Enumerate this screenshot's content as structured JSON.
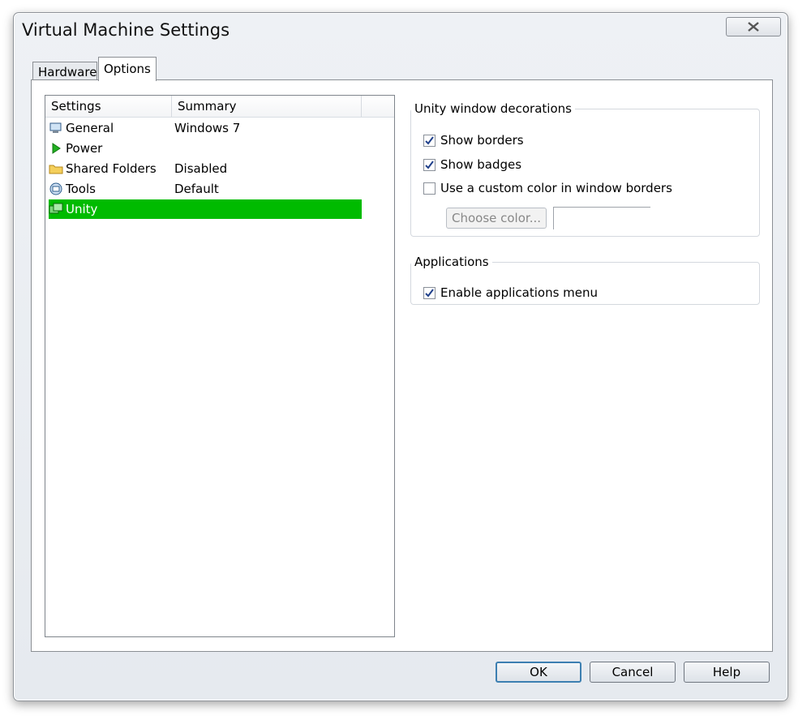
{
  "window": {
    "title": "Virtual Machine Settings"
  },
  "tabs": [
    {
      "label": "Hardware"
    },
    {
      "label": "Options"
    }
  ],
  "list": {
    "headers": {
      "settings": "Settings",
      "summary": "Summary"
    },
    "rows": [
      {
        "label": "General",
        "summary": "Windows 7",
        "icon": "general-icon"
      },
      {
        "label": "Power",
        "summary": "",
        "icon": "power-icon"
      },
      {
        "label": "Shared Folders",
        "summary": "Disabled",
        "icon": "folder-icon"
      },
      {
        "label": "Tools",
        "summary": "Default",
        "icon": "tools-icon"
      },
      {
        "label": "Unity",
        "summary": "",
        "icon": "unity-icon",
        "selected": true
      }
    ]
  },
  "unity_group": {
    "legend": "Unity window decorations",
    "show_borders": {
      "label": "Show borders",
      "checked": true
    },
    "show_badges": {
      "label": "Show badges",
      "checked": true
    },
    "custom_color": {
      "label": "Use a custom color in window borders",
      "checked": false
    },
    "choose_color": "Choose color..."
  },
  "applications_group": {
    "legend": "Applications",
    "enable_menu": {
      "label": "Enable applications menu",
      "checked": true
    }
  },
  "buttons": {
    "ok": "OK",
    "cancel": "Cancel",
    "help": "Help"
  },
  "colors": {
    "selection": "#00bb00",
    "focus_border": "#3c7fb1"
  }
}
